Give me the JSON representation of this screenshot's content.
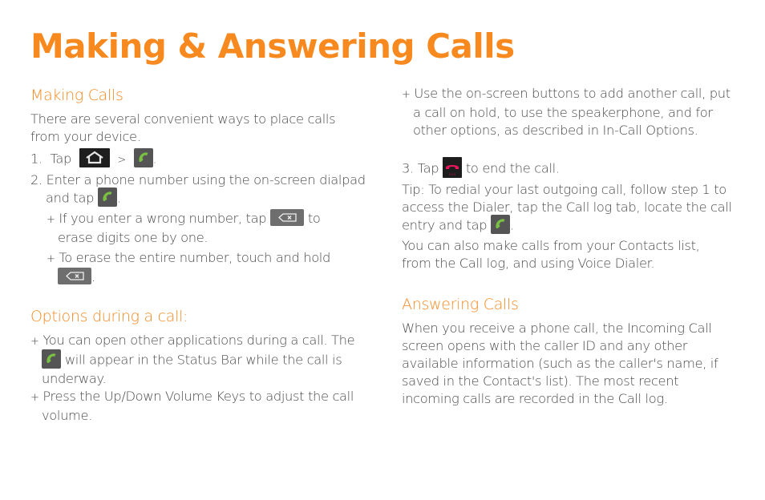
{
  "page_title": "Making & Answering Calls",
  "making_calls": {
    "heading": "Making Calls",
    "intro": "There are several convenient ways to place calls from your device.",
    "step1": {
      "num": "1.",
      "text_a": "Tap",
      "sep": ">",
      "end": "."
    },
    "step2": {
      "num": "2.",
      "text_a": "Enter a phone number using the on-screen dialpad and tap",
      "end": "."
    },
    "bullet_wrong": {
      "mark": "+",
      "text_a": "If you enter a wrong number, tap",
      "text_b": "to erase digits one by one."
    },
    "bullet_erase": {
      "mark": "+",
      "text_a": "To erase the entire number, touch and hold",
      "end": "."
    }
  },
  "options": {
    "heading": "Options during a call:",
    "bullet_apps": {
      "mark": "+",
      "text_a": "You can open other applications during a call. The",
      "text_b": "will appear in the Status Bar while the call is underway."
    },
    "bullet_volume": {
      "mark": "+",
      "text": "Press the Up/Down Volume Keys to adjust the call volume."
    },
    "bullet_buttons": {
      "mark": "+",
      "text": "Use the on-screen buttons to add another call, put a call on hold, to use the speakerphone, and for other options, as described in In-Call Options."
    },
    "step3": {
      "num": "3.",
      "text_a": "Tap",
      "text_b": "to end the call."
    },
    "tip": {
      "text_a": "Tip: To redial your last outgoing call, follow step 1 to access the Dialer, tap the Call log tab, locate the call entry and tap",
      "end": "."
    },
    "also": "You can also make calls from your Contacts list, from the Call log, and using Voice Dialer."
  },
  "answering": {
    "heading": "Answering Calls",
    "body": "When you receive a phone call, the Incoming Call screen opens with the caller ID and any other available information (such as the caller's name, if saved in the Contact's list). The most recent incoming calls are recorded in the Call log."
  },
  "icons": {
    "end_label": "End"
  },
  "colors": {
    "accent": "#f7891f",
    "text": "#4a4a4a",
    "phone_green": "#7ac143",
    "end_red": "#e8175d"
  }
}
